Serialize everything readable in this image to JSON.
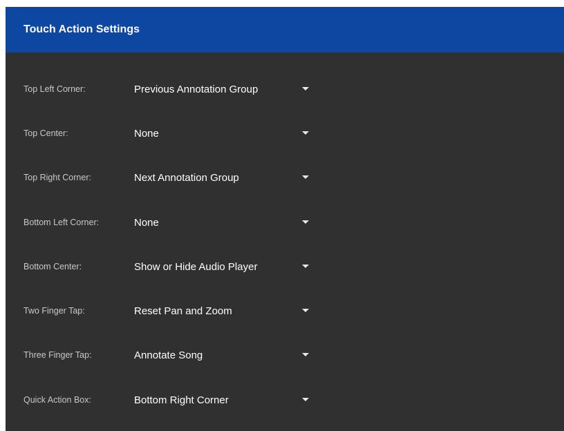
{
  "header": {
    "title": "Touch Action Settings"
  },
  "rows": [
    {
      "label": "Top Left Corner:",
      "value": "Previous Annotation Group"
    },
    {
      "label": "Top Center:",
      "value": "None"
    },
    {
      "label": "Top Right Corner:",
      "value": "Next Annotation Group"
    },
    {
      "label": "Bottom Left Corner:",
      "value": "None"
    },
    {
      "label": "Bottom Center:",
      "value": "Show or Hide Audio Player"
    },
    {
      "label": "Two Finger Tap:",
      "value": "Reset Pan and Zoom"
    },
    {
      "label": "Three Finger Tap:",
      "value": "Annotate Song"
    },
    {
      "label": "Quick Action Box:",
      "value": "Bottom Right Corner"
    }
  ],
  "icons": {
    "dropdown": "caret-down-icon"
  },
  "colors": {
    "header_bg": "#0d47a1",
    "panel_bg": "#303030",
    "label_text": "#c8c8c8",
    "value_text": "#ffffff"
  }
}
